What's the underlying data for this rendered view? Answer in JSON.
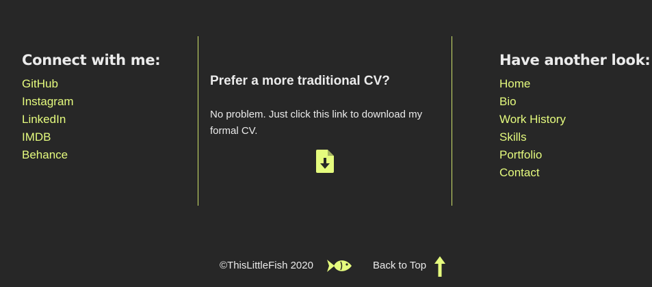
{
  "connect": {
    "heading": "Connect with me:",
    "links": [
      "GitHub",
      "Instagram",
      "LinkedIn",
      "IMDB",
      "Behance"
    ]
  },
  "cv": {
    "title": "Prefer a more traditional CV?",
    "text": "No problem. Just click this link to download my formal CV.",
    "icon": "file-download-icon"
  },
  "navigation": {
    "heading": "Have another look:",
    "links": [
      "Home",
      "Bio",
      "Work History",
      "Skills",
      "Portfolio",
      "Contact"
    ]
  },
  "bottom": {
    "copyright": "©ThisLittleFish 2020",
    "logo_icon": "fish-icon",
    "back_to_top": "Back to Top",
    "back_icon": "arrow-up-icon"
  },
  "colors": {
    "background": "#272727",
    "accent": "#e5fb7e",
    "text": "#ebebeb"
  }
}
